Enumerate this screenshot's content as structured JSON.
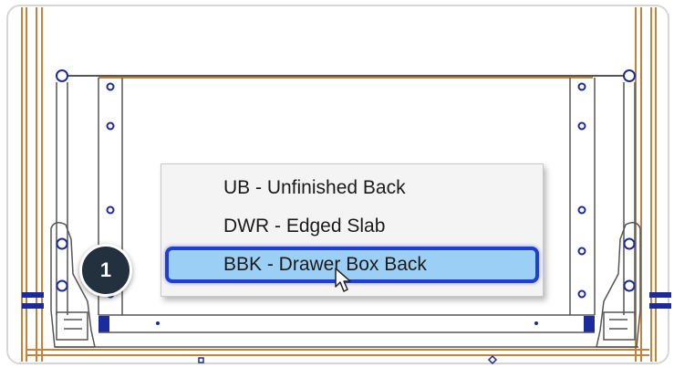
{
  "context_menu": {
    "items": [
      {
        "label": "UB - Unfinished Back"
      },
      {
        "label": "DWR - Edged Slab"
      },
      {
        "label": "BBK - Drawer Box Back",
        "highlighted": true
      }
    ]
  },
  "step_badge": {
    "number": "1"
  },
  "colors": {
    "frame": "#c9813a",
    "outline": "#555555",
    "hardware": "#1c2b9b",
    "highlight_fill": "#9ccff5",
    "highlight_border": "#1f3fd1",
    "badge": "#23303e"
  },
  "icons": [
    "hinge-hole-icon",
    "mouse-pointer-icon"
  ]
}
